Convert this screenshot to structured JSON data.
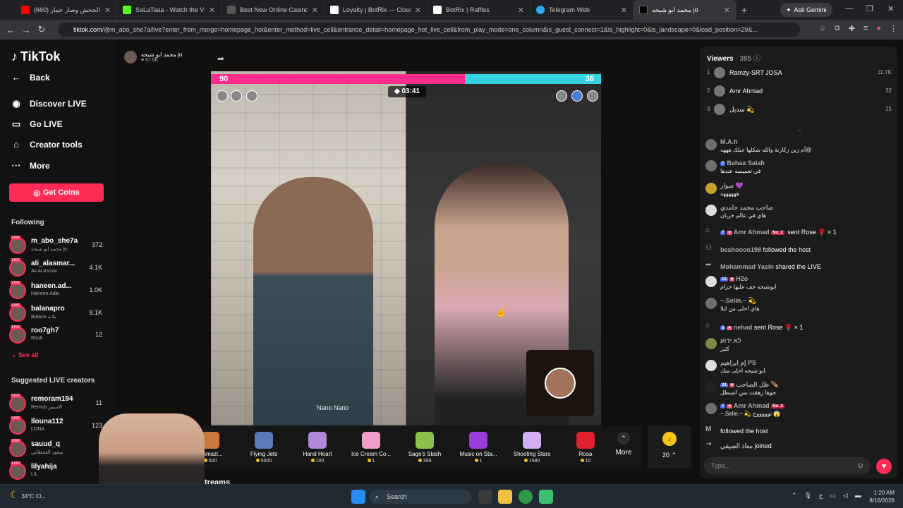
{
  "browser": {
    "tabs": [
      {
        "title": "(660) كبر الجحش وصار حمار",
        "color": "#ff0000"
      },
      {
        "title": "SaLaTaaa - Watch the VOD",
        "color": "#53fc18"
      },
      {
        "title": "Best New Online Casino",
        "color": "#4c6ef5"
      },
      {
        "title": "Loyalty | BotRix — Cloud St",
        "color": "#ffffff"
      },
      {
        "title": "BotRix | Raffles",
        "color": "#ffffff"
      },
      {
        "title": "Telegram Web",
        "color": "#2aabee"
      },
      {
        "title": "محمد ابو شيحه jo",
        "color": "#000000"
      }
    ],
    "gemini_label": "Ask Gemini",
    "url_host": "tiktok.com",
    "url_rest": "/@m_abo_she7a/live?enter_from_merge=homepage_hot&enter_method=live_cell&entrance_detail=homepage_hot_live_cell&from_play_mode=one_column&is_guest_connect=1&is_highlight=0&is_landscape=0&load_position=29&..."
  },
  "sidebar": {
    "logo": "TikTok",
    "back": "Back",
    "nav": [
      "Discover LIVE",
      "Go LIVE",
      "Creator tools",
      "More"
    ],
    "get_coins": "Get Coins",
    "following_title": "Following",
    "following": [
      {
        "name": "m_abo_she7a",
        "sub": "محمد ابو شيحه jo",
        "count": "372"
      },
      {
        "name": "ali_alasmar...",
        "sub": "Ali Al Asmar",
        "count": "4.1K"
      },
      {
        "name": "haneen.ad...",
        "sub": "Haneen Adel",
        "count": "1.0K"
      },
      {
        "name": "balanapro",
        "sub": "Balana بلانة",
        "count": "8.1K"
      },
      {
        "name": "roo7gh7",
        "sub": "Rouh",
        "count": "12"
      }
    ],
    "see_all": "See all",
    "suggested_title": "Suggested LIVE creators",
    "suggested": [
      {
        "name": "remoram194",
        "sub": "Remoo الاسمر",
        "count": "11"
      },
      {
        "name": "llouna112",
        "sub": "LONA",
        "count": "123"
      },
      {
        "name": "sauud_q",
        "sub": "سعود القحطاني",
        "count": ""
      },
      {
        "name": "lilyahija",
        "sub": "LIL",
        "count": ""
      }
    ]
  },
  "stream": {
    "host_name": "محمد ابو شيحه jo",
    "host_likes": "67.6K",
    "score_left": "90",
    "score_right": "36",
    "timer": "03:41",
    "left_label": "Nano Nano",
    "more_label": "More",
    "coin_count": "20",
    "streams_label": "treams",
    "gifts": [
      {
        "name": "e Amazi...",
        "price": "500",
        "color": "#c8783c"
      },
      {
        "name": "Flying Jets",
        "price": "5000",
        "color": "#5a7ab8"
      },
      {
        "name": "Hand Heart",
        "price": "100",
        "color": "#b088d8"
      },
      {
        "name": "Ice Cream Co...",
        "price": "1",
        "color": "#f0a0c8"
      },
      {
        "name": "Sage's Slash",
        "price": "399",
        "color": "#8ec04a"
      },
      {
        "name": "Music on Sta...",
        "price": "1",
        "color": "#9a3cd8"
      },
      {
        "name": "Shooting Stars",
        "price": "1580",
        "color": "#d0b0f0"
      },
      {
        "name": "Rosa",
        "price": "10",
        "color": "#e02030"
      }
    ]
  },
  "panel": {
    "viewers_title": "Viewers",
    "viewers_count": "· 385",
    "top_viewers": [
      {
        "rank": "1",
        "name": "Ramzy-SRT JOSA",
        "score": "11.7K"
      },
      {
        "rank": "2",
        "name": "Amr Ahmad",
        "score": "32"
      },
      {
        "rank": "3",
        "name": "سديل 💫",
        "score": "25"
      }
    ],
    "chat": [
      {
        "user": "M.A.h",
        "text": "أم زين زكارنة والله شكلها حيلك هههه@"
      },
      {
        "user": "Bahaa Salah",
        "text": "في تغميسه عندها",
        "badge": "7"
      },
      {
        "user": "سوار 💜",
        "text": "ههههههه"
      },
      {
        "user": "صاحب محمد حامدي",
        "text": "هاي في عالم خربان"
      },
      {
        "user": "Amr Ahmad",
        "text": "sent Rose 🌹 × 1",
        "badge": "7",
        "single": true
      },
      {
        "user": "beshoooo198",
        "text": "followed the host",
        "single": true
      },
      {
        "user": "Mohammad Yasin",
        "text": "shared the LIVE",
        "single": true
      },
      {
        "user": "H2o",
        "text": "ابوشيحه خف عليها حرام",
        "badge": "10"
      },
      {
        "user": "~.Selin.~ 💫",
        "text": "هاي احلى من ايلا"
      },
      {
        "user": "nehad",
        "text": "sent Rose 🌹 × 1",
        "badge": "5",
        "single": true
      },
      {
        "user": "לא ידוע",
        "text": "كثير"
      },
      {
        "user": "إم ابراهيم PS",
        "text": "ابو شيحه احلى منك"
      },
      {
        "user": "ظل الصاحب 🪶",
        "text": "جوها زهقت بس اتسطل",
        "badge": "24"
      },
      {
        "user": "Amr Ahmad",
        "text": "~.Selin.~ 💫 توووووح 😱",
        "badge": "7"
      },
      {
        "user": "M",
        "text": "followed the host",
        "single": true
      },
      {
        "user": "معاذ الصيفي",
        "text": "joined",
        "single": true
      }
    ],
    "type_placeholder": "Type..."
  },
  "taskbar": {
    "temp": "34°C",
    "weather": "Cl...",
    "search": "Search",
    "time": "1:20 AM",
    "date": "8/16/2026"
  }
}
